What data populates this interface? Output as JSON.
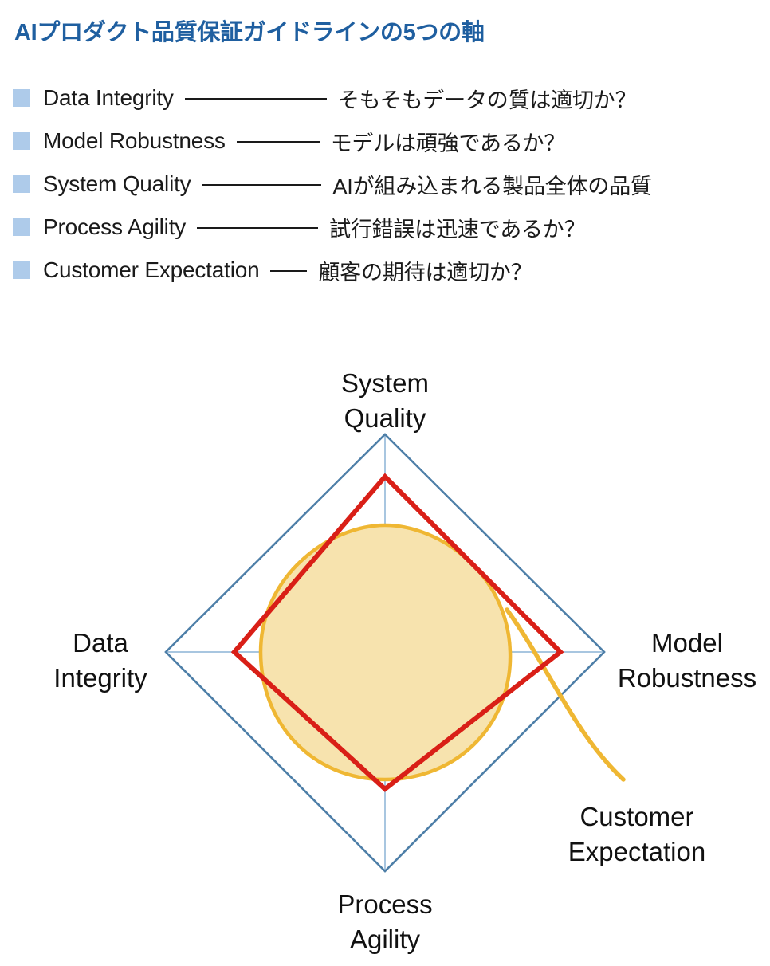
{
  "title": "AIプロダクト品質保証ガイドラインの5つの軸",
  "colors": {
    "title": "#1F5FA0",
    "swatch": "#AECBEA",
    "grid": "#4E7FA8",
    "spoke": "#A8C6E0",
    "series_red": "#D91F17",
    "series_yellow_line": "#EFB733",
    "series_yellow_fill": "#F7E3AE",
    "text": "#1A1A1A"
  },
  "legend": {
    "items": [
      {
        "term": "Data Integrity",
        "description": "そもそもデータの質は適切か？"
      },
      {
        "term": "Model Robustness",
        "description": "モデルは頑強であるか？"
      },
      {
        "term": "System Quality",
        "description": "AIが組み込まれる製品全体の品質"
      },
      {
        "term": "Process Agility",
        "description": "試行錯誤は迅速であるか？"
      },
      {
        "term": "Customer Expectation",
        "description": "顧客の期待は適切か？"
      }
    ]
  },
  "chart_data": {
    "type": "radar",
    "title": "",
    "axes": [
      {
        "label_line1": "System",
        "label_line2": "Quality",
        "angle_deg": 90
      },
      {
        "label_line1": "Model",
        "label_line2": "Robustness",
        "angle_deg": 0
      },
      {
        "label_line1": "Process",
        "label_line2": "Agility",
        "angle_deg": 270
      },
      {
        "label_line1": "Data",
        "label_line2": "Integrity",
        "angle_deg": 180
      },
      {
        "label_line1": "Customer",
        "label_line2": "Expectation",
        "angle_deg": 315
      }
    ],
    "categories": [
      "System Quality",
      "Model Robustness",
      "Process Agility",
      "Data Integrity"
    ],
    "rmax": 1.0,
    "grid": "diamond outline only (outer ring), spokes shown",
    "legend_position": "none",
    "series": [
      {
        "name": "red-outline",
        "style": "line",
        "color": "#D91F17",
        "values": [
          0.8,
          0.8,
          0.63,
          0.69
        ]
      },
      {
        "name": "yellow-filled",
        "style": "area-rounded",
        "color": "#EFB733",
        "fill": "#F7E3AE",
        "values": [
          0.58,
          0.57,
          0.58,
          0.57
        ],
        "tail": "extends past Model Robustness/Process Agility edge toward Customer Expectation"
      }
    ]
  }
}
